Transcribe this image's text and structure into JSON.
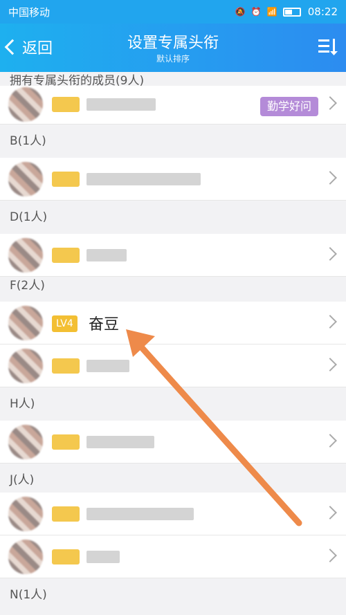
{
  "status_bar": {
    "carrier": "中国移动",
    "time": "08:22"
  },
  "nav": {
    "back_label": "返回",
    "title": "设置专属头衔",
    "subtitle": "默认排序"
  },
  "sections": {
    "special": "拥有专属头衔的成员(9人)",
    "b": "B(1人)",
    "d": "D(1人)",
    "f": "F(2人)",
    "h": "H人)",
    "j": "J(人)",
    "n": "N(1人)"
  },
  "rows": {
    "special_tag": "勤学好问",
    "fendou_level": "LV4",
    "fendou_name": "奋豆"
  },
  "colors": {
    "header_start": "#1eb0ef",
    "header_end": "#2c8cf0",
    "arrow": "#ee8a4a"
  }
}
